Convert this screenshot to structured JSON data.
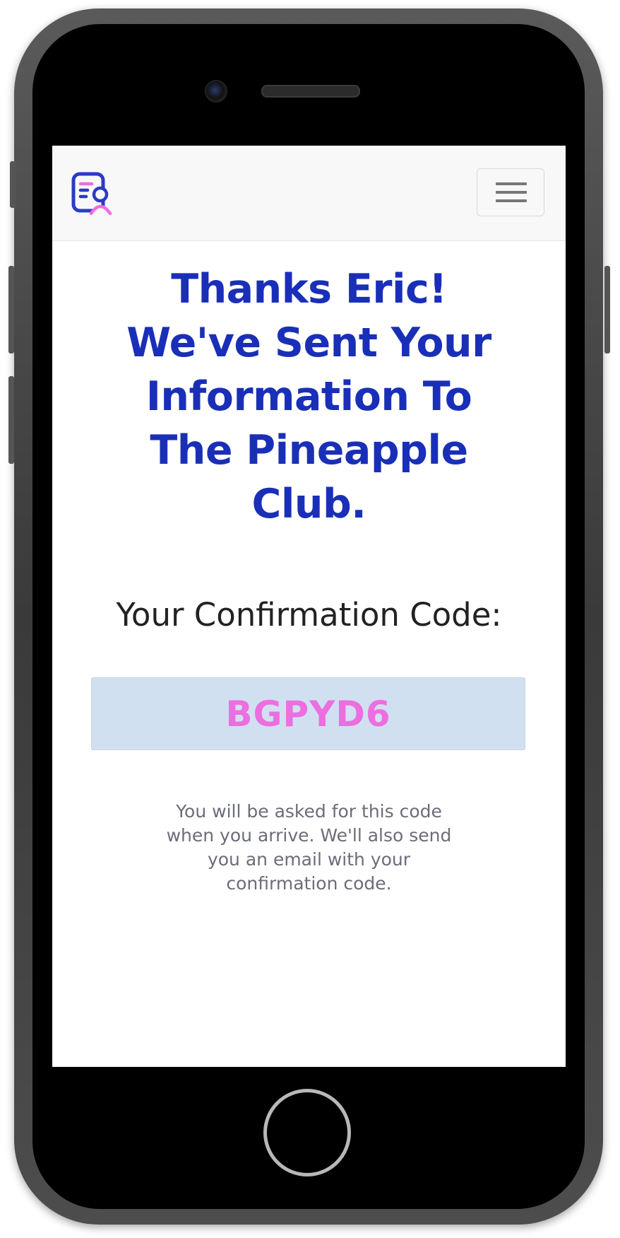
{
  "header": {
    "logo_icon": "profile-document-icon",
    "menu_icon": "hamburger-menu-icon"
  },
  "colors": {
    "headline": "#1a2fb8",
    "code_text": "#ec6ee0",
    "code_background": "#d1e0f0",
    "logo_primary": "#2b3bc4",
    "logo_accent": "#ec6ee0"
  },
  "main": {
    "headline_lines": [
      "Thanks Eric!",
      "We've Sent Your",
      "Information To",
      "The Pineapple",
      "Club."
    ],
    "code_label": "Your Confirmation Code:",
    "confirmation_code": "BGPYD6",
    "note_lines": [
      "You will be asked for this code",
      "when you arrive. We'll also send",
      "you an email with your",
      "confirmation code."
    ]
  }
}
